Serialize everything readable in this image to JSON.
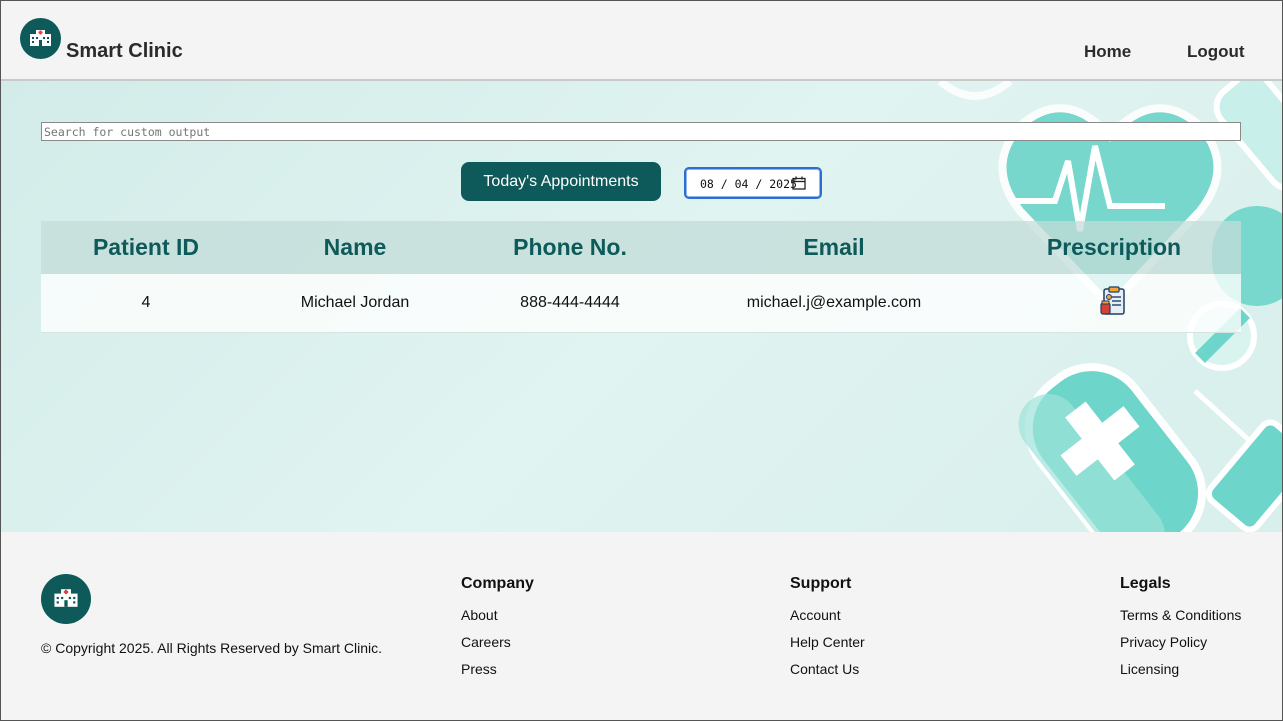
{
  "header": {
    "brand": "Smart Clinic",
    "logo_icon": "hospital-icon",
    "nav": {
      "home": "Home",
      "logout": "Logout"
    }
  },
  "main": {
    "search": {
      "placeholder": "Search for custom output"
    },
    "today_button": "Today's Appointments",
    "date": {
      "value": "08 / 04 / 2025",
      "icon": "calendar-icon"
    },
    "table": {
      "headers": {
        "patient_id": "Patient ID",
        "name": "Name",
        "phone": "Phone No.",
        "email": "Email",
        "prescription": "Prescription"
      },
      "rows": [
        {
          "patient_id": "4",
          "name": "Michael Jordan",
          "phone": "888-444-4444",
          "email": "michael.j@example.com",
          "prescription_icon": "prescription-icon"
        }
      ]
    }
  },
  "footer": {
    "logo_icon": "hospital-icon",
    "copyright": "© Copyright 2025. All Rights Reserved by Smart Clinic.",
    "columns": [
      {
        "title": "Company",
        "links": [
          "About",
          "Careers",
          "Press"
        ]
      },
      {
        "title": "Support",
        "links": [
          "Account",
          "Help Center",
          "Contact Us"
        ]
      },
      {
        "title": "Legals",
        "links": [
          "Terms & Conditions",
          "Privacy Policy",
          "Licensing"
        ]
      }
    ]
  },
  "colors": {
    "primary": "#0e5a5a",
    "accent": "#6dd5c9",
    "background": "#f4f4f4",
    "focus": "#2d6fd1"
  }
}
